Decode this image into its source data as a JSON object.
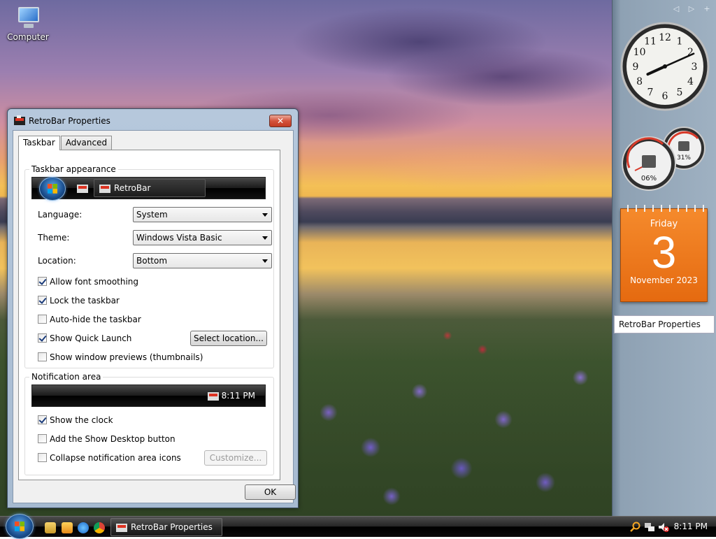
{
  "desktop": {
    "icons": [
      {
        "label": "Computer",
        "icon": "computer-icon"
      }
    ]
  },
  "sidebar": {
    "nav": {
      "prev": "◁",
      "next": "▷",
      "add": "+"
    },
    "clock": {
      "numbers": [
        "12",
        "1",
        "2",
        "3",
        "4",
        "5",
        "6",
        "7",
        "8",
        "9",
        "10",
        "11"
      ],
      "time_hours": 8,
      "time_minutes": 11
    },
    "meters": {
      "cpu_label": "06%",
      "mem_label": "31%"
    },
    "calendar": {
      "day_name": "Friday",
      "day_number": "3",
      "month_year": "November 2023"
    },
    "tooltip": "RetroBar Properties"
  },
  "window": {
    "title": "RetroBar Properties",
    "close_label": "✕",
    "tabs": [
      {
        "label": "Taskbar",
        "active": true
      },
      {
        "label": "Advanced",
        "active": false
      }
    ],
    "taskbar_appearance": {
      "group_title": "Taskbar appearance",
      "preview_task_label": "RetroBar",
      "language": {
        "label": "Language:",
        "value": "System"
      },
      "theme": {
        "label": "Theme:",
        "value": "Windows Vista Basic"
      },
      "location": {
        "label": "Location:",
        "value": "Bottom"
      },
      "checks": {
        "font_smoothing": {
          "label": "Allow font smoothing",
          "checked": true
        },
        "lock_taskbar": {
          "label": "Lock the taskbar",
          "checked": true
        },
        "auto_hide": {
          "label": "Auto-hide the taskbar",
          "checked": false
        },
        "quick_launch": {
          "label": "Show Quick Launch",
          "checked": true
        },
        "window_previews": {
          "label": "Show window previews (thumbnails)",
          "checked": false
        }
      },
      "select_location_button": "Select location..."
    },
    "notification_area": {
      "group_title": "Notification area",
      "preview_time": "8:11 PM",
      "checks": {
        "show_clock": {
          "label": "Show the clock",
          "checked": true
        },
        "show_desktop": {
          "label": "Add the Show Desktop button",
          "checked": false
        },
        "collapse_icons": {
          "label": "Collapse notification area icons",
          "checked": false
        }
      },
      "customize_button": "Customize..."
    },
    "ok_button": "OK"
  },
  "taskbar": {
    "task_label": "RetroBar Properties",
    "clock": "8:11 PM",
    "colors": {
      "orb": "#1b4f8f",
      "bar": "#000000"
    }
  }
}
